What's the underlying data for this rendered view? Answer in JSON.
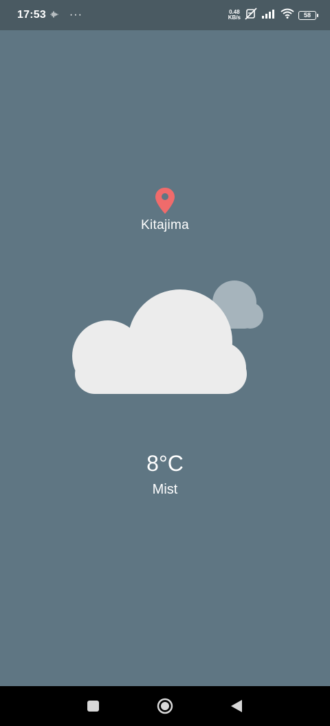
{
  "status_bar": {
    "time": "17:53",
    "net_speed_value": "0.48",
    "net_speed_unit": "KB/s",
    "battery_level": "58"
  },
  "location": {
    "city": "Kitajima",
    "pin_color": "#f06b6b"
  },
  "weather": {
    "icon": "cloud-icon",
    "temperature": "8°C",
    "description": "Mist"
  },
  "colors": {
    "background": "#5f7683",
    "status_bar": "#4a5a62",
    "cloud_front": "#ececec",
    "cloud_back": "#a6b4bc"
  },
  "nav_bar": {
    "recents_icon": "square-icon",
    "home_icon": "circle-icon",
    "back_icon": "triangle-back-icon"
  }
}
